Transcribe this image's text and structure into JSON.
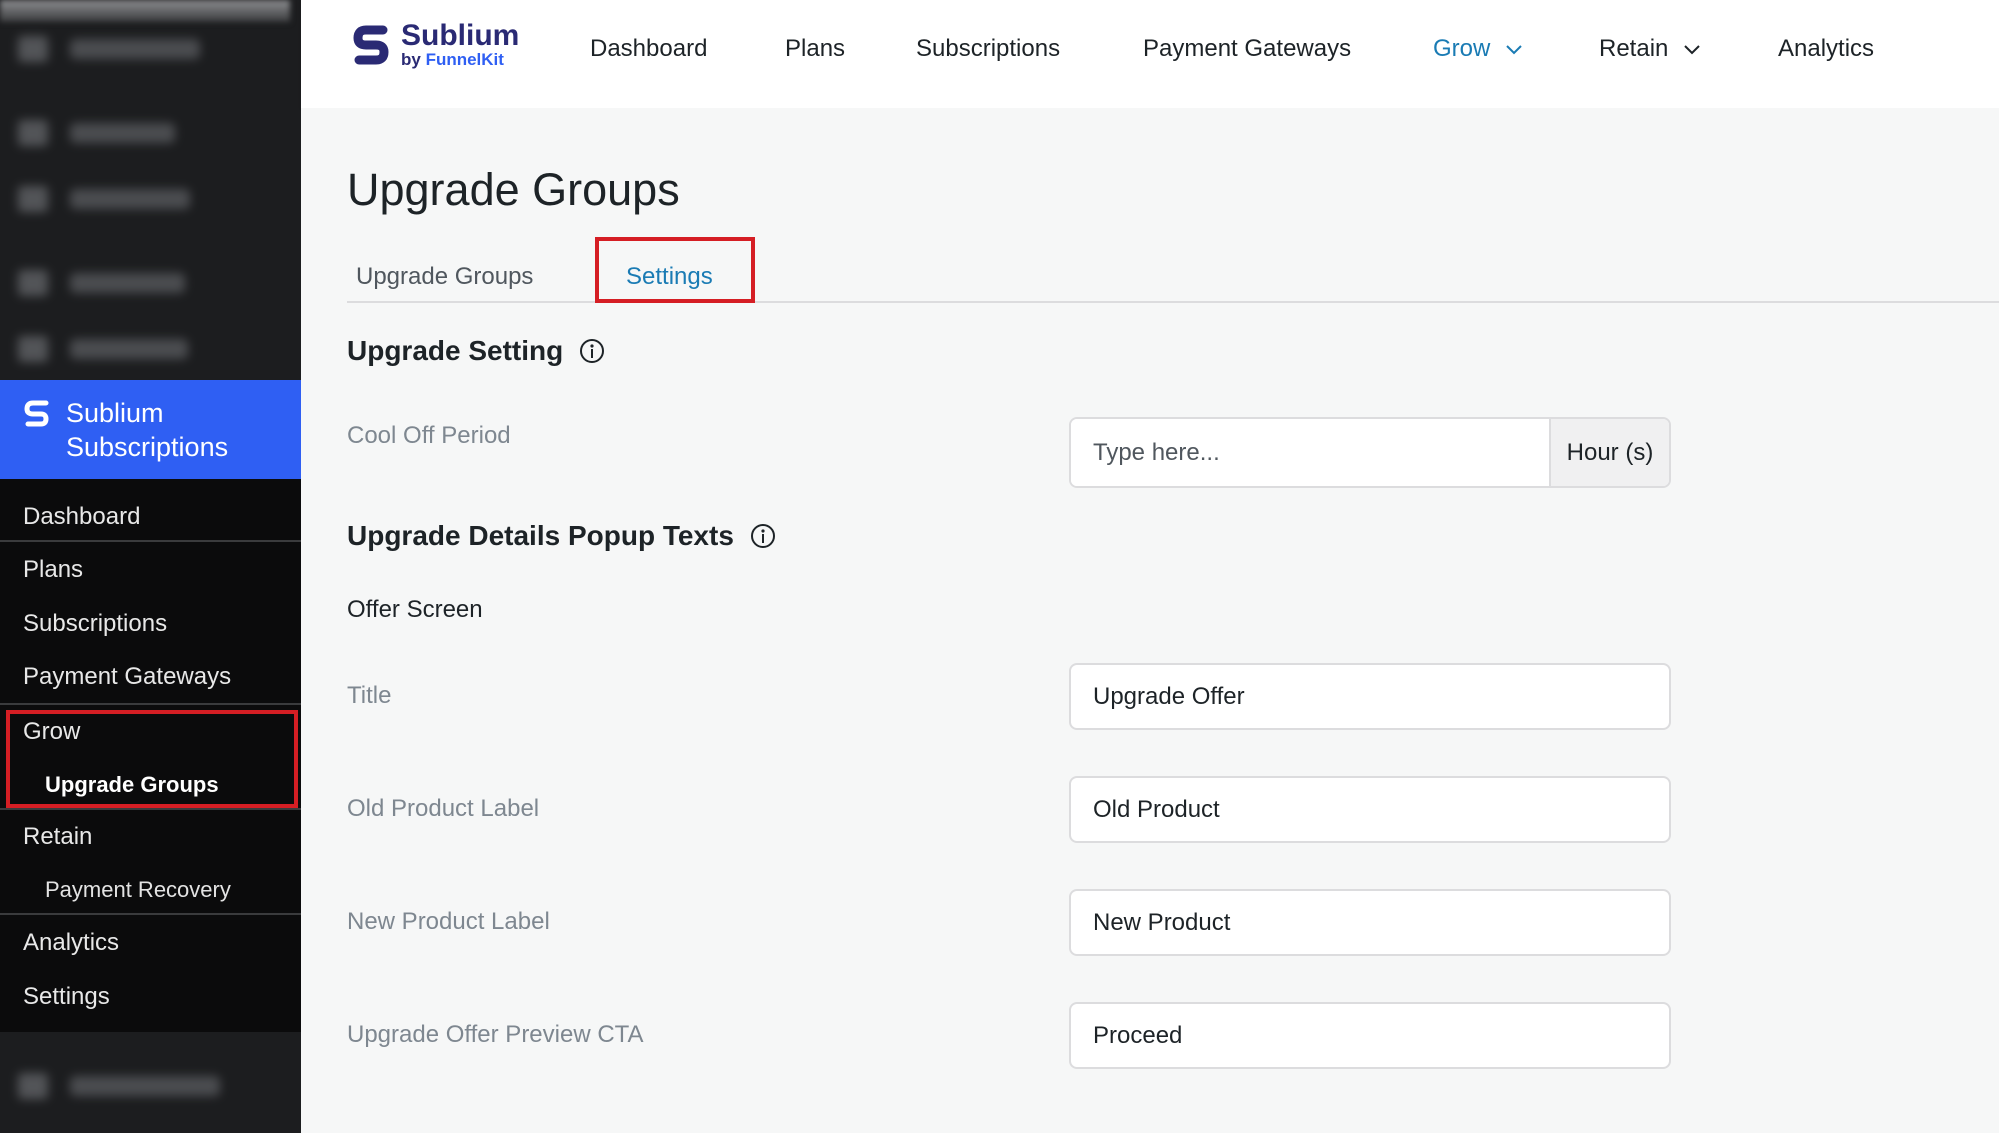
{
  "sidebar": {
    "brand_line1": "Sublium",
    "brand_line2": "Subscriptions",
    "items": [
      {
        "label": "Dashboard"
      },
      {
        "label": "Plans"
      },
      {
        "label": "Subscriptions"
      },
      {
        "label": "Payment Gateways"
      },
      {
        "label": "Grow"
      },
      {
        "label": "Upgrade Groups"
      },
      {
        "label": "Retain"
      },
      {
        "label": "Payment Recovery"
      },
      {
        "label": "Analytics"
      },
      {
        "label": "Settings"
      }
    ]
  },
  "topnav": {
    "logo_name": "Sublium",
    "logo_by": "by ",
    "logo_by_brand": "FunnelKit",
    "items": [
      {
        "label": "Dashboard"
      },
      {
        "label": "Plans"
      },
      {
        "label": "Subscriptions"
      },
      {
        "label": "Payment Gateways"
      },
      {
        "label": "Grow"
      },
      {
        "label": "Retain"
      },
      {
        "label": "Analytics"
      }
    ]
  },
  "page": {
    "title": "Upgrade Groups",
    "tabs": [
      {
        "label": "Upgrade Groups"
      },
      {
        "label": "Settings"
      }
    ]
  },
  "upgrade_setting": {
    "heading": "Upgrade Setting",
    "cool_off_label": "Cool Off Period",
    "cool_off_placeholder": "Type here...",
    "cool_off_suffix": "Hour (s)"
  },
  "popup_texts": {
    "heading": "Upgrade Details Popup Texts",
    "offer_screen": "Offer Screen",
    "fields": [
      {
        "label": "Title",
        "value": "Upgrade Offer"
      },
      {
        "label": "Old Product Label",
        "value": "Old Product"
      },
      {
        "label": "New Product Label",
        "value": "New Product"
      },
      {
        "label": "Upgrade Offer Preview CTA",
        "value": "Proceed"
      }
    ]
  },
  "colors": {
    "accent": "#1a7bb4",
    "brand_blue": "#2f5ff3",
    "highlight_red": "#d51e24"
  }
}
